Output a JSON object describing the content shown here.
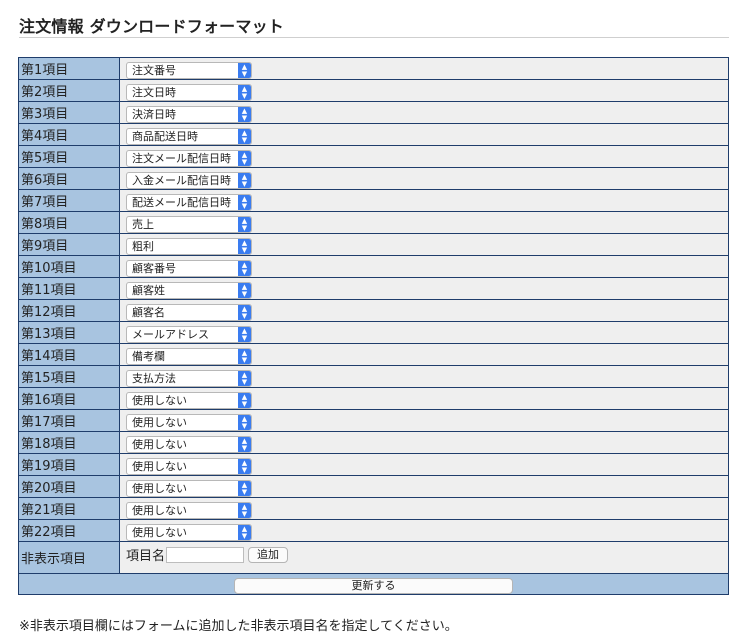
{
  "page_title": "注文情報 ダウンロードフォーマット",
  "rows": [
    {
      "label": "第1項目",
      "value": "注文番号"
    },
    {
      "label": "第2項目",
      "value": "注文日時"
    },
    {
      "label": "第3項目",
      "value": "決済日時"
    },
    {
      "label": "第4項目",
      "value": "商品配送日時"
    },
    {
      "label": "第5項目",
      "value": "注文メール配信日時"
    },
    {
      "label": "第6項目",
      "value": "入金メール配信日時"
    },
    {
      "label": "第7項目",
      "value": "配送メール配信日時"
    },
    {
      "label": "第8項目",
      "value": "売上"
    },
    {
      "label": "第9項目",
      "value": "粗利"
    },
    {
      "label": "第10項目",
      "value": "顧客番号"
    },
    {
      "label": "第11項目",
      "value": "顧客姓"
    },
    {
      "label": "第12項目",
      "value": "顧客名"
    },
    {
      "label": "第13項目",
      "value": "メールアドレス"
    },
    {
      "label": "第14項目",
      "value": "備考欄"
    },
    {
      "label": "第15項目",
      "value": "支払方法"
    },
    {
      "label": "第16項目",
      "value": "使用しない"
    },
    {
      "label": "第17項目",
      "value": "使用しない"
    },
    {
      "label": "第18項目",
      "value": "使用しない"
    },
    {
      "label": "第19項目",
      "value": "使用しない"
    },
    {
      "label": "第20項目",
      "value": "使用しない"
    },
    {
      "label": "第21項目",
      "value": "使用しない"
    },
    {
      "label": "第22項目",
      "value": "使用しない"
    }
  ],
  "hidden_items": {
    "label": "非表示項目",
    "field_label": "項目名",
    "input_value": "",
    "add_label": "追加"
  },
  "update_label": "更新する",
  "note": "※非表示項目欄にはフォームに追加した非表示項目名を指定してください。",
  "colors": {
    "label_bg": "#a8c4e0",
    "value_bg": "#efefef",
    "border": "#1f3d6b",
    "select_arrow": "#3a7cf0"
  }
}
